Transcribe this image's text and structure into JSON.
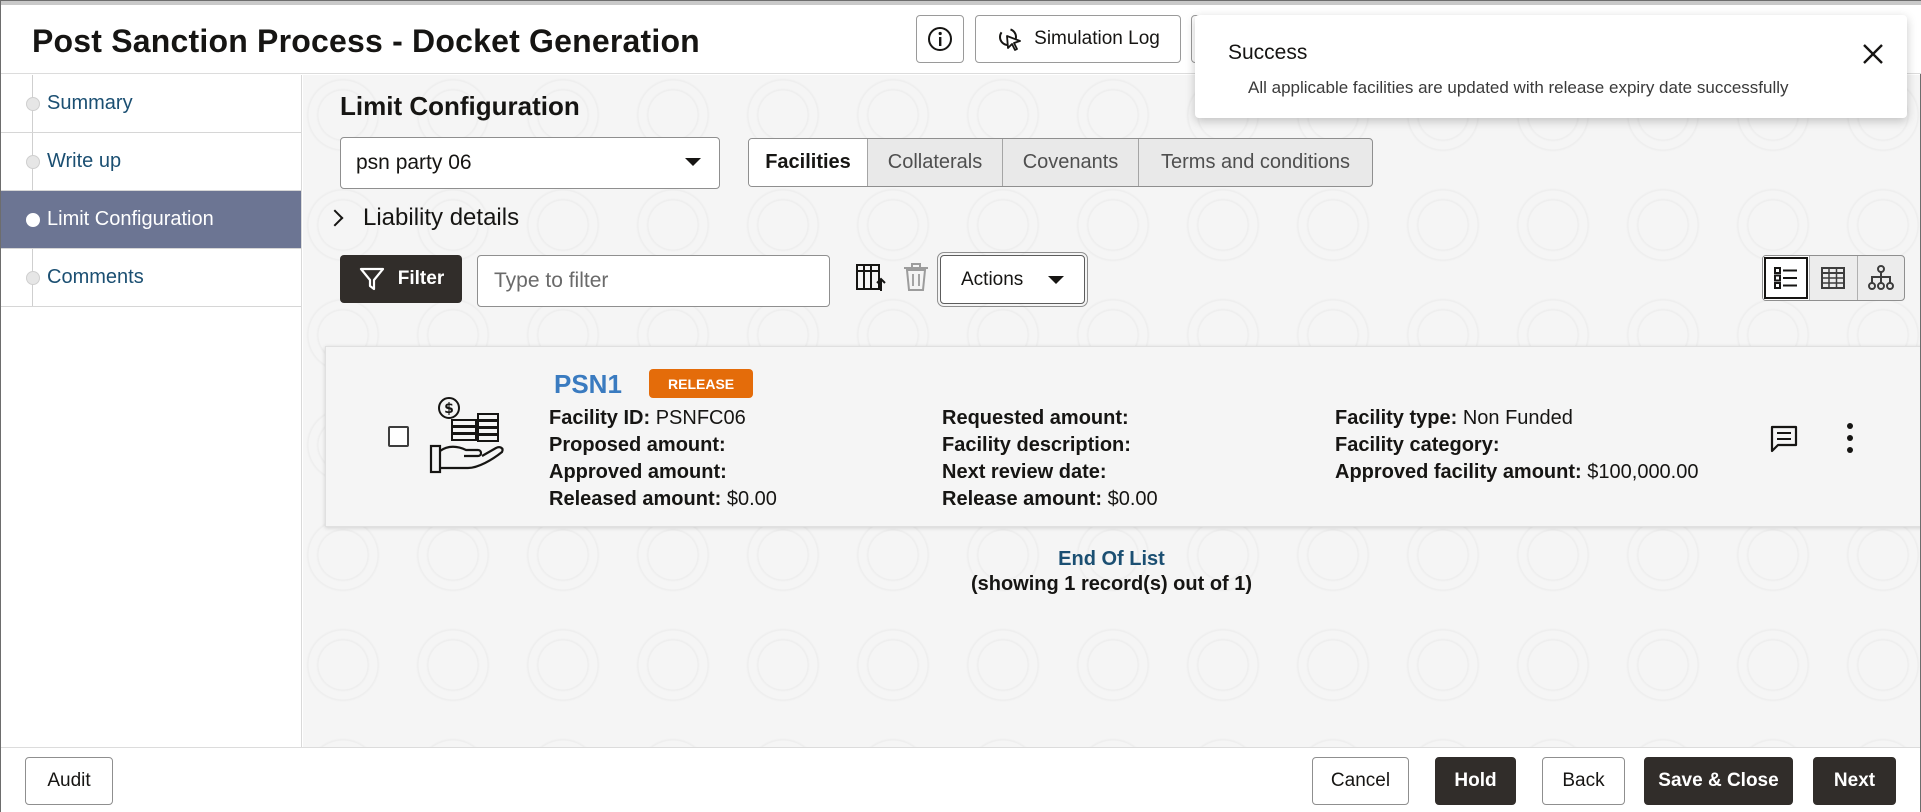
{
  "header": {
    "title": "Post Sanction Process - Docket Generation",
    "info_icon": "info-icon",
    "simulation_log_label": "Simulation Log",
    "simulation_log_icon": "cursor-click-icon"
  },
  "sidebar": {
    "items": [
      {
        "label": "Summary"
      },
      {
        "label": "Write up"
      },
      {
        "label": "Limit Configuration",
        "active": true
      },
      {
        "label": "Comments"
      }
    ]
  },
  "main": {
    "section_title": "Limit Configuration",
    "party_select_value": "psn party 06",
    "tabs": [
      "Facilities",
      "Collaterals",
      "Covenants",
      "Terms and conditions"
    ],
    "liability_label": "Liability details",
    "filter_button": "Filter",
    "filter_placeholder": "Type to filter",
    "actions_label": "Actions"
  },
  "facility_card": {
    "title": "PSN1",
    "badge": "RELEASE",
    "fields": {
      "facility_id_label": "Facility ID:",
      "facility_id": "PSNFC06",
      "proposed_label": "Proposed amount:",
      "approved_label": "Approved amount:",
      "released_label": "Released amount:",
      "released": "$0.00",
      "requested_label": "Requested amount:",
      "description_label": "Facility description:",
      "review_label": "Next review date:",
      "release_amount_label": "Release amount:",
      "release_amount": "$0.00",
      "type_label": "Facility type:",
      "type": "Non Funded",
      "category_label": "Facility category:",
      "approved_facility_label": "Approved facility amount:",
      "approved_facility": "$100,000.00"
    }
  },
  "list_footer": {
    "end_label": "End Of List",
    "count_label": "(showing 1 record(s) out of 1)"
  },
  "footer": {
    "audit": "Audit",
    "cancel": "Cancel",
    "hold": "Hold",
    "back": "Back",
    "save_close": "Save & Close",
    "next": "Next"
  },
  "toast": {
    "title": "Success",
    "message": "All applicable facilities are updated with release expiry date successfully"
  },
  "colors": {
    "active_nav": "#6c7593",
    "dark_button": "#312d2a",
    "badge": "#e46c0a",
    "link": "#1b4f72",
    "card_title": "#3a7bc0"
  }
}
